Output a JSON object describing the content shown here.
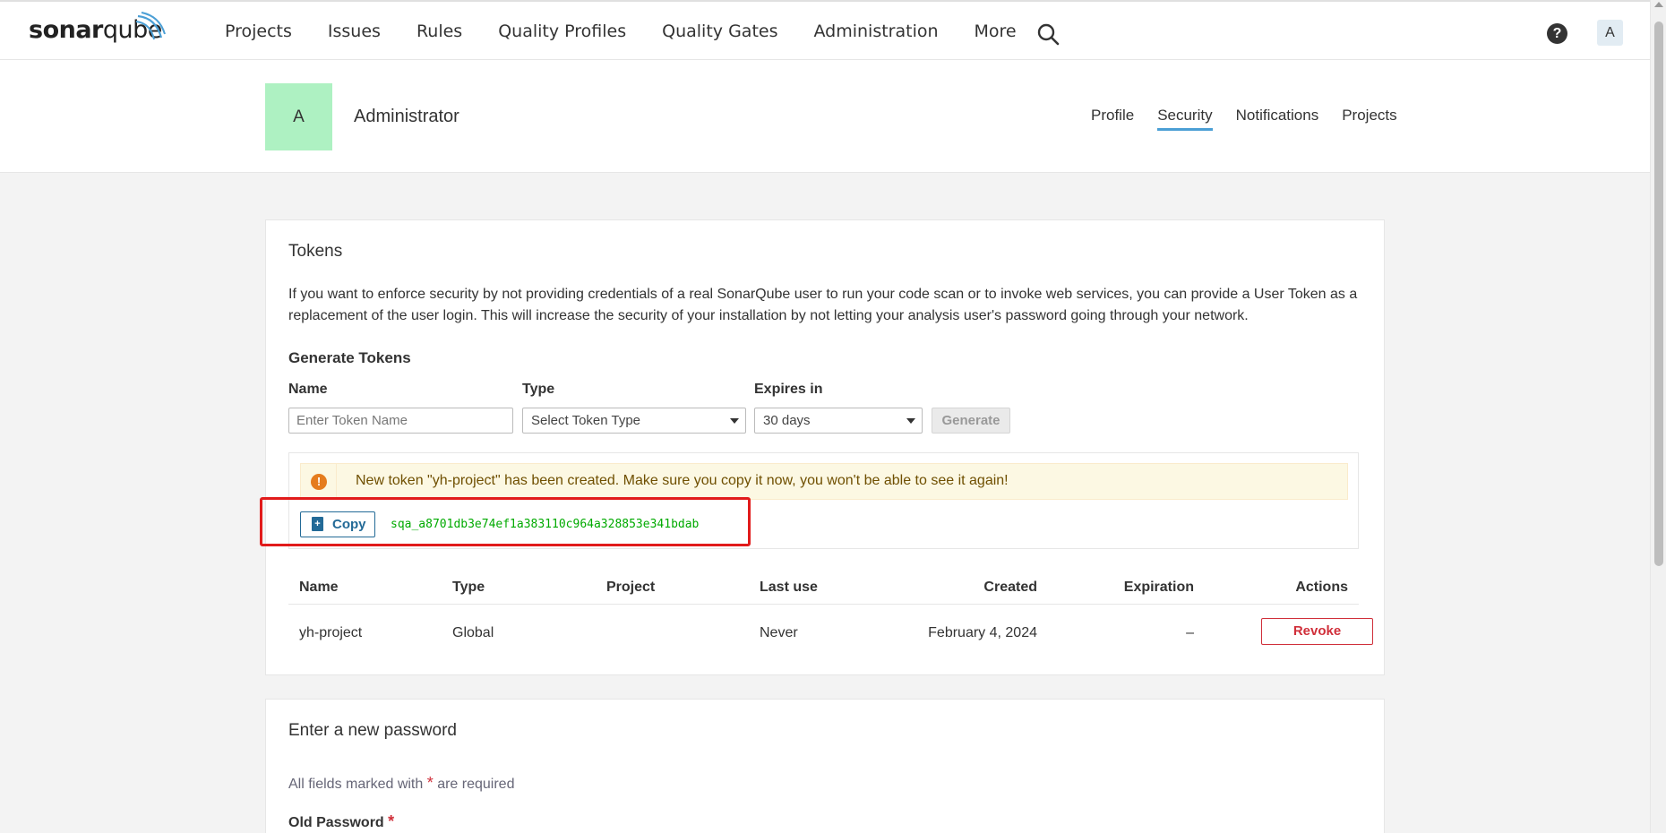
{
  "topnav": {
    "logo_part1": "sonar",
    "logo_part2": "qube",
    "items": [
      "Projects",
      "Issues",
      "Rules",
      "Quality Profiles",
      "Quality Gates",
      "Administration",
      "More"
    ],
    "help_label": "?",
    "user_initial": "A"
  },
  "user_header": {
    "avatar_initial": "A",
    "name": "Administrator",
    "tabs": [
      "Profile",
      "Security",
      "Notifications",
      "Projects"
    ],
    "active_tab": "Security"
  },
  "tokens": {
    "title": "Tokens",
    "intro": "If you want to enforce security by not providing credentials of a real SonarQube user to run your code scan or to invoke web services, you can provide a User Token as a replacement of the user login. This will increase the security of your installation by not letting your analysis user's password going through your network.",
    "generate_title": "Generate Tokens",
    "name_label": "Name",
    "name_placeholder": "Enter Token Name",
    "type_label": "Type",
    "type_value": "Select Token Type",
    "expires_label": "Expires in",
    "expires_value": "30 days",
    "generate_button": "Generate",
    "alert_icon": "!",
    "alert_text": "New token \"yh-project\" has been created. Make sure you copy it now, you won't be able to see it again!",
    "copy_button": "Copy",
    "token_value": "sqa_a8701db3e74ef1a383110c964a328853e341bdab",
    "table": {
      "headers": [
        "Name",
        "Type",
        "Project",
        "Last use",
        "Created",
        "Expiration",
        "Actions"
      ],
      "rows": [
        {
          "name": "yh-project",
          "type": "Global",
          "project": "",
          "last_use": "Never",
          "created": "February 4, 2024",
          "expiration": "–",
          "action": "Revoke"
        }
      ]
    }
  },
  "password": {
    "title": "Enter a new password",
    "required_note_before": "All fields marked with",
    "required_star": "*",
    "required_note_after": "are required",
    "old_password_label": "Old Password",
    "old_password_star": "*"
  },
  "colors": {
    "accent": "#4b9fd5",
    "avatar_bg": "#aef1c2",
    "token_green": "#00aa00",
    "danger": "#d02f3a",
    "highlight": "#e11b1b"
  }
}
